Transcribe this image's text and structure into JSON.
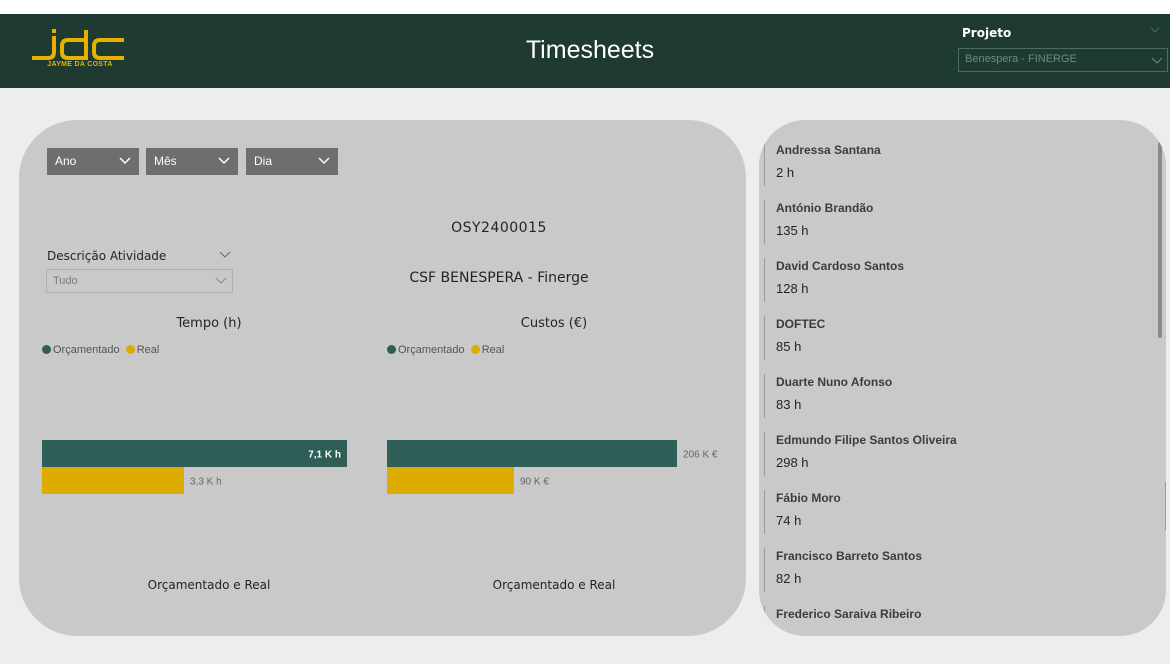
{
  "header": {
    "logo_text": "JDC",
    "logo_subtitle": "JAYME DA COSTA",
    "title": "Timesheets",
    "projeto_label": "Projeto",
    "projeto_value": "Benespera - FINERGE"
  },
  "filters": {
    "ano": "Ano",
    "mes": "Mês",
    "dia": "Dia",
    "descricao_label": "Descrição Atividade",
    "descricao_value": "Tudo"
  },
  "project": {
    "code": "OSY2400015",
    "company": "CSF BENESPERA - Finerge"
  },
  "colors": {
    "header_bg": "#1e3a31",
    "orcamentado": "#2f5e56",
    "real": "#dcac00",
    "panel_bg": "#c9c9c9"
  },
  "chart_data": [
    {
      "type": "bar",
      "title": "Tempo (h)",
      "xlabel": "Orçamentado e Real",
      "legend_position": "top-left",
      "series": [
        {
          "name": "Orçamentado",
          "value": 7100,
          "label": "7,1 K h",
          "color": "#2f5e56"
        },
        {
          "name": "Real",
          "value": 3300,
          "label": "3,3 K h",
          "color": "#dcac00"
        }
      ],
      "xlim": [
        0,
        7100
      ]
    },
    {
      "type": "bar",
      "title": "Custos (€)",
      "xlabel": "Orçamentado e Real",
      "legend_position": "top-left",
      "series": [
        {
          "name": "Orçamentado",
          "value": 206000,
          "label": "206 K €",
          "color": "#2f5e56"
        },
        {
          "name": "Real",
          "value": 90000,
          "label": "90 K €",
          "color": "#dcac00"
        }
      ],
      "xlim": [
        0,
        206000
      ]
    }
  ],
  "people": [
    {
      "name": "Andressa Santana",
      "hours": "2 h"
    },
    {
      "name": "António Brandão",
      "hours": "135 h"
    },
    {
      "name": "David Cardoso Santos",
      "hours": "128 h"
    },
    {
      "name": "DOFTEC",
      "hours": "85 h"
    },
    {
      "name": "Duarte Nuno Afonso",
      "hours": "83 h"
    },
    {
      "name": "Edmundo Filipe Santos Oliveira",
      "hours": "298 h"
    },
    {
      "name": "Fábio Moro",
      "hours": "74 h"
    },
    {
      "name": "Francisco Barreto Santos",
      "hours": "82 h"
    },
    {
      "name": "Frederico Saraiva Ribeiro",
      "hours": ""
    }
  ]
}
